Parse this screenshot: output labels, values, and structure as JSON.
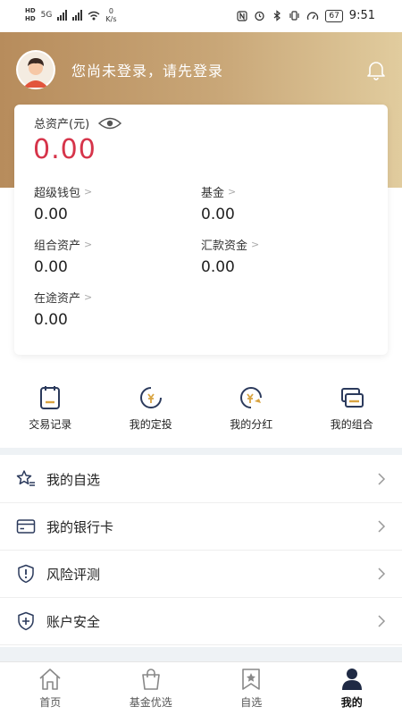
{
  "status_bar": {
    "hd_top": "HD",
    "hd_bottom": "HD",
    "network": "5G",
    "net_speed_value": "0",
    "net_speed_unit": "K/s",
    "battery": "67",
    "time": "9:51"
  },
  "header": {
    "login_prompt": "您尚未登录，请先登录"
  },
  "assets": {
    "total_label": "总资产(元)",
    "total_value": "0.00",
    "items": [
      {
        "label": "超级钱包",
        "value": "0.00"
      },
      {
        "label": "基金",
        "value": "0.00"
      },
      {
        "label": "组合资产",
        "value": "0.00"
      },
      {
        "label": "汇款资金",
        "value": "0.00"
      },
      {
        "label": "在途资产",
        "value": "0.00"
      }
    ]
  },
  "quick_actions": [
    {
      "label": "交易记录",
      "icon": "transaction-record-icon"
    },
    {
      "label": "我的定投",
      "icon": "fixed-investment-icon"
    },
    {
      "label": "我的分红",
      "icon": "dividend-icon"
    },
    {
      "label": "我的组合",
      "icon": "portfolio-icon"
    }
  ],
  "menu": [
    {
      "label": "我的自选",
      "icon": "star-list-icon"
    },
    {
      "label": "我的银行卡",
      "icon": "bank-card-icon"
    },
    {
      "label": "风险评测",
      "icon": "shield-alert-icon"
    },
    {
      "label": "账户安全",
      "icon": "shield-plus-icon"
    }
  ],
  "bottom_nav": [
    {
      "label": "首页",
      "icon": "home-icon"
    },
    {
      "label": "基金优选",
      "icon": "shopping-bag-icon"
    },
    {
      "label": "自选",
      "icon": "bookmark-star-icon"
    },
    {
      "label": "我的",
      "icon": "person-icon",
      "active": true
    }
  ],
  "colors": {
    "brand_gold": "#c9a778",
    "value_red": "#d6344a",
    "icon_navy": "#2b3a5c",
    "icon_gold": "#d9a441"
  }
}
